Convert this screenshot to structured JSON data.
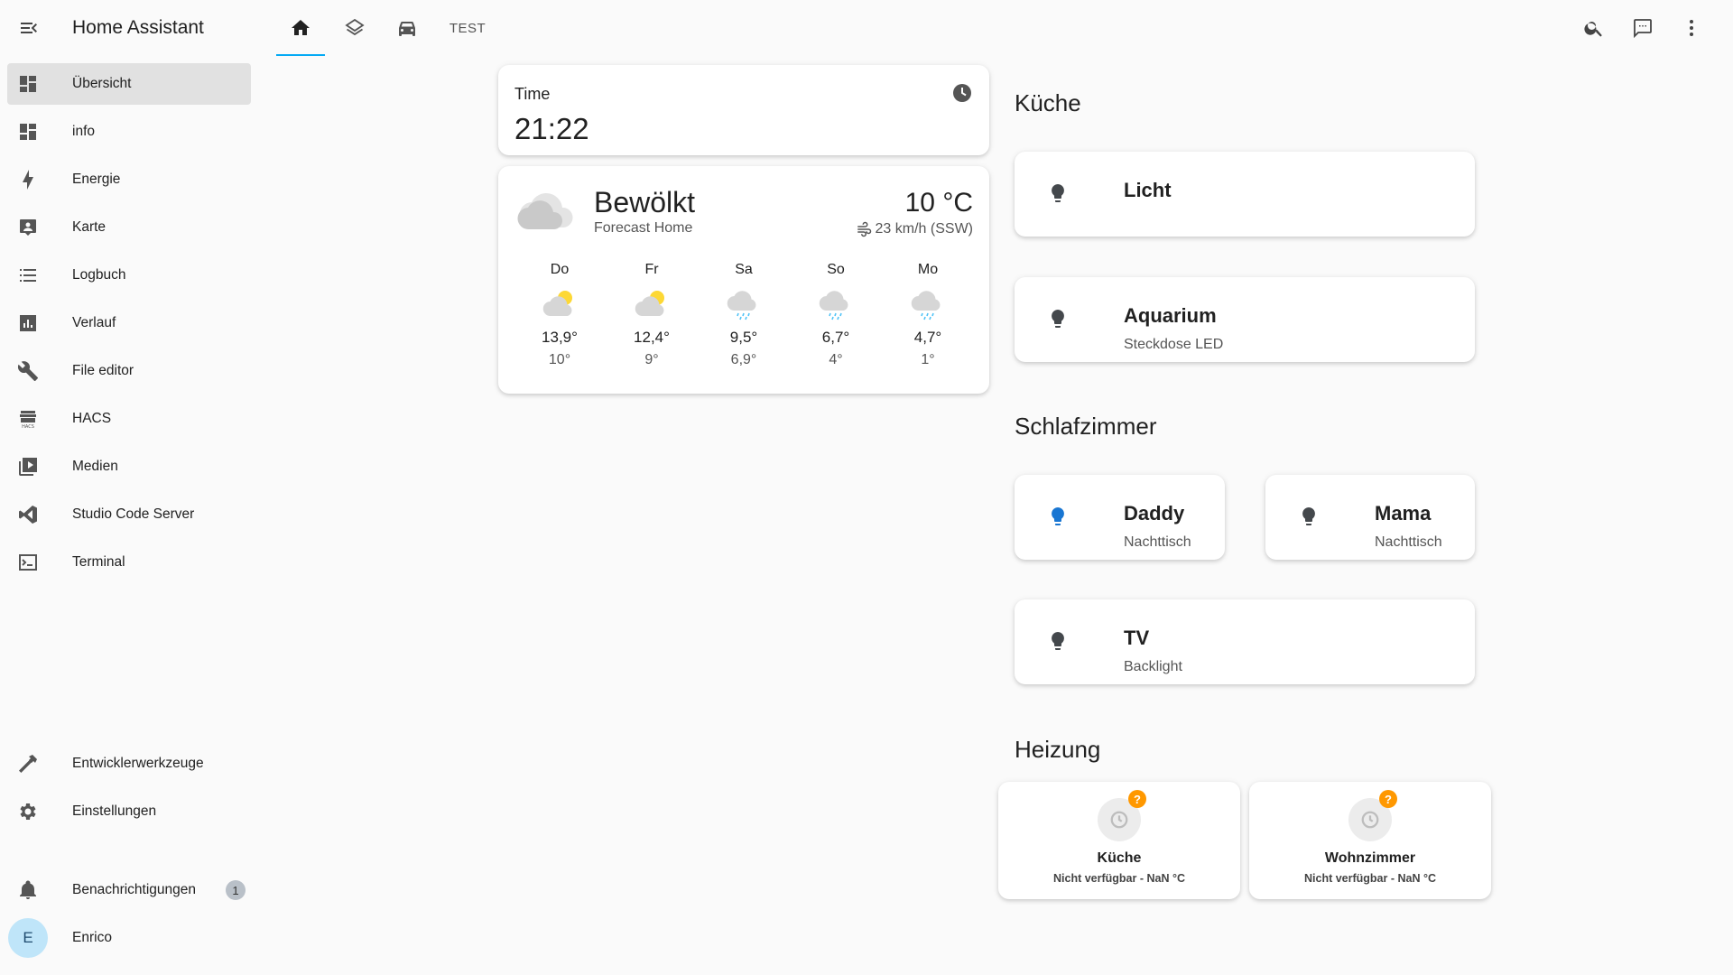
{
  "app": {
    "title": "Home Assistant"
  },
  "sidebar": {
    "items": [
      {
        "label": "Übersicht",
        "icon": "view-dashboard-icon",
        "active": true
      },
      {
        "label": "info",
        "icon": "view-dashboard-icon"
      },
      {
        "label": "Energie",
        "icon": "lightning-bolt-icon"
      },
      {
        "label": "Karte",
        "icon": "account-box-icon"
      },
      {
        "label": "Logbuch",
        "icon": "format-list-bulleted-icon"
      },
      {
        "label": "Verlauf",
        "icon": "chart-box-icon"
      },
      {
        "label": "File editor",
        "icon": "wrench-icon"
      },
      {
        "label": "HACS",
        "icon": "hacs-store-icon"
      },
      {
        "label": "Medien",
        "icon": "play-box-multiple-icon"
      },
      {
        "label": "Studio Code Server",
        "icon": "vscode-icon"
      },
      {
        "label": "Terminal",
        "icon": "console-icon"
      }
    ],
    "bottom": {
      "dev_tools": "Entwicklerwerkzeuge",
      "settings": "Einstellungen",
      "notifications": "Benachrichtigungen",
      "notifications_count": "1",
      "user_initial": "E",
      "user_name": "Enrico"
    }
  },
  "topbar": {
    "tabs": [
      {
        "icon": "home-icon",
        "active": true
      },
      {
        "icon": "layers-icon"
      },
      {
        "icon": "car-icon"
      },
      {
        "label": "TEST"
      }
    ],
    "actions": [
      "search-icon",
      "assist-icon",
      "more-vertical-icon"
    ]
  },
  "time_card": {
    "label": "Time",
    "value": "21:22"
  },
  "weather": {
    "condition": "Bewölkt",
    "location": "Forecast Home",
    "temperature": "10 °C",
    "wind": "23 km/h (SSW)",
    "forecast": [
      {
        "day": "Do",
        "icon": "partly-cloudy-icon",
        "high": "13,9°",
        "low": "10°"
      },
      {
        "day": "Fr",
        "icon": "partly-cloudy-icon",
        "high": "12,4°",
        "low": "9°"
      },
      {
        "day": "Sa",
        "icon": "rainy-icon",
        "high": "9,5°",
        "low": "6,9°"
      },
      {
        "day": "So",
        "icon": "rainy-icon",
        "high": "6,7°",
        "low": "4°"
      },
      {
        "day": "Mo",
        "icon": "rainy-icon",
        "high": "4,7°",
        "low": "1°"
      }
    ]
  },
  "sections": {
    "kueche": {
      "title": "Küche",
      "licht": {
        "name": "Licht"
      },
      "aquarium": {
        "name": "Aquarium",
        "sub": "Steckdose LED"
      }
    },
    "schlafzimmer": {
      "title": "Schlafzimmer",
      "daddy": {
        "name": "Daddy",
        "sub": "Nachttisch",
        "on_color": "#1976d2"
      },
      "mama": {
        "name": "Mama",
        "sub": "Nachttisch"
      },
      "tv": {
        "name": "TV",
        "sub": "Backlight"
      }
    },
    "heizung": {
      "title": "Heizung",
      "kueche": {
        "name": "Küche",
        "state": "Nicht verfügbar - NaN °C"
      },
      "wohnzimmer": {
        "name": "Wohnzimmer",
        "state": "Nicht verfügbar - NaN °C"
      }
    }
  },
  "colors": {
    "accent": "#03a9f4",
    "badge": "#ff9800",
    "sun": "#fdd835",
    "rain": "#4fc3f7"
  }
}
